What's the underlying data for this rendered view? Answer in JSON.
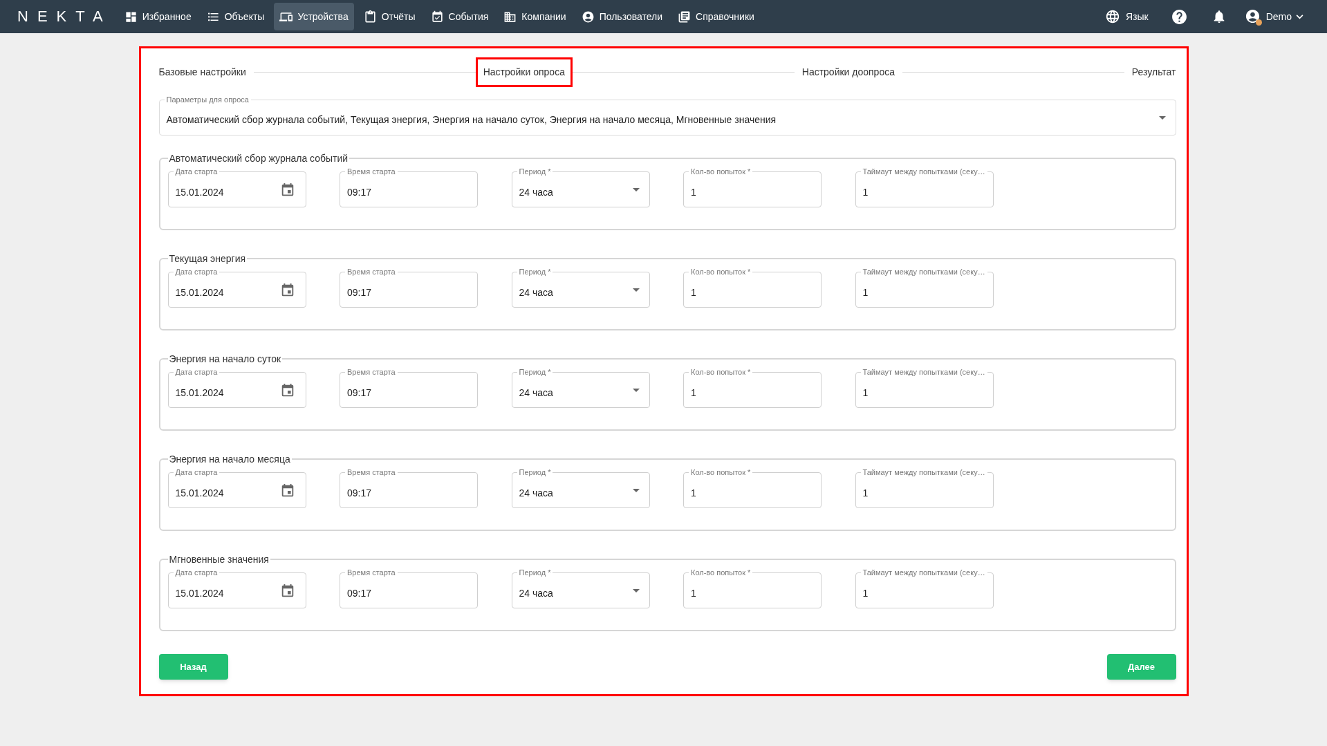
{
  "nav": {
    "logo": "NEKTA",
    "items": [
      {
        "label": "Избранное",
        "selected": false
      },
      {
        "label": "Объекты",
        "selected": false
      },
      {
        "label": "Устройства",
        "selected": true
      },
      {
        "label": "Отчёты",
        "selected": false
      },
      {
        "label": "События",
        "selected": false
      },
      {
        "label": "Компании",
        "selected": false
      },
      {
        "label": "Пользователи",
        "selected": false
      },
      {
        "label": "Справочники",
        "selected": false
      }
    ],
    "language": "Язык",
    "user": "Demo"
  },
  "panel": {
    "highlighted": true
  },
  "steps": [
    {
      "label": "Базовые настройки",
      "highlighted": false
    },
    {
      "label": "Настройки опроса",
      "highlighted": true
    },
    {
      "label": "Настройки доопроса",
      "highlighted": false
    },
    {
      "label": "Результат",
      "highlighted": false
    }
  ],
  "params_select": {
    "label": "Параметры для опроса",
    "value": "Автоматический сбор журнала событий, Текущая энергия, Энергия на начало суток, Энергия на начало месяца, Мгновенные значения"
  },
  "groups": [
    {
      "legend": "Автоматический сбор журнала событий",
      "fields": [
        {
          "kind": "date",
          "label": "Дата старта",
          "value": "15.01.2024"
        },
        {
          "kind": "text",
          "label": "Время старта",
          "value": "09:17"
        },
        {
          "kind": "select",
          "label": "Период *",
          "value": "24 часа"
        },
        {
          "kind": "text",
          "label": "Кол-во попыток *",
          "value": "1"
        },
        {
          "kind": "text",
          "label": "Таймаут между попытками (секу…",
          "value": "1"
        }
      ]
    },
    {
      "legend": "Текущая энергия",
      "fields": [
        {
          "kind": "date",
          "label": "Дата старта",
          "value": "15.01.2024"
        },
        {
          "kind": "text",
          "label": "Время старта",
          "value": "09:17"
        },
        {
          "kind": "select",
          "label": "Период *",
          "value": "24 часа"
        },
        {
          "kind": "text",
          "label": "Кол-во попыток *",
          "value": "1"
        },
        {
          "kind": "text",
          "label": "Таймаут между попытками (секу…",
          "value": "1"
        }
      ]
    },
    {
      "legend": "Энергия на начало суток",
      "fields": [
        {
          "kind": "date",
          "label": "Дата старта",
          "value": "15.01.2024"
        },
        {
          "kind": "text",
          "label": "Время старта",
          "value": "09:17"
        },
        {
          "kind": "select",
          "label": "Период *",
          "value": "24 часа"
        },
        {
          "kind": "text",
          "label": "Кол-во попыток *",
          "value": "1"
        },
        {
          "kind": "text",
          "label": "Таймаут между попытками (секу…",
          "value": "1"
        }
      ]
    },
    {
      "legend": "Энергия на начало месяца",
      "fields": [
        {
          "kind": "date",
          "label": "Дата старта",
          "value": "15.01.2024"
        },
        {
          "kind": "text",
          "label": "Время старта",
          "value": "09:17"
        },
        {
          "kind": "select",
          "label": "Период *",
          "value": "24 часа"
        },
        {
          "kind": "text",
          "label": "Кол-во попыток *",
          "value": "1"
        },
        {
          "kind": "text",
          "label": "Таймаут между попытками (секу…",
          "value": "1"
        }
      ]
    },
    {
      "legend": "Мгновенные значения",
      "fields": [
        {
          "kind": "date",
          "label": "Дата старта",
          "value": "15.01.2024"
        },
        {
          "kind": "text",
          "label": "Время старта",
          "value": "09:17"
        },
        {
          "kind": "select",
          "label": "Период *",
          "value": "24 часа"
        },
        {
          "kind": "text",
          "label": "Кол-во попыток *",
          "value": "1"
        },
        {
          "kind": "text",
          "label": "Таймаут между попытками (секу…",
          "value": "1"
        }
      ]
    }
  ],
  "buttons": {
    "back": "Назад",
    "next": "Далее"
  }
}
